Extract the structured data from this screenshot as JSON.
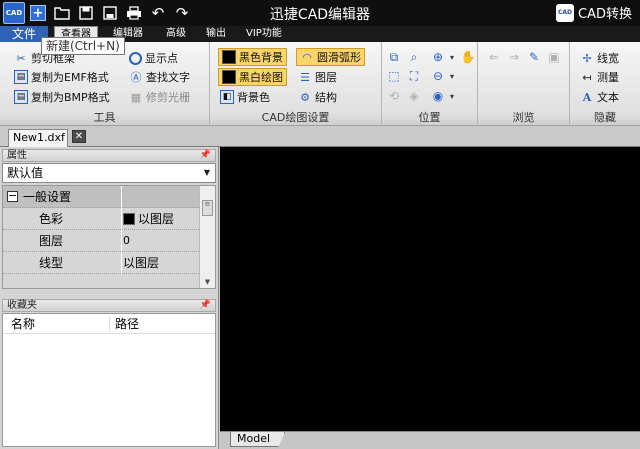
{
  "titlebar": {
    "title": "迅捷CAD编辑器",
    "logo_text": "CAD",
    "convert_badge": "CAD",
    "convert_label": "CAD转换",
    "quick_access_icons": [
      "app-logo-icon",
      "new-file-icon",
      "open-folder-icon",
      "save-icon",
      "save-as-icon",
      "print-icon",
      "undo-icon",
      "redo-icon"
    ]
  },
  "menu": {
    "tabs": [
      "文件",
      "查看器",
      "编辑器",
      "高级",
      "输出",
      "VIP功能"
    ],
    "active": "查看器"
  },
  "tooltip": {
    "text": "新建(Ctrl+N)"
  },
  "ribbon": {
    "tools": {
      "label": "工具",
      "items": [
        "剪切框架",
        "复制为EMF格式",
        "复制为BMP格式",
        "显示点",
        "查找文字",
        "修剪光栅"
      ],
      "disabled": [
        "修剪光栅"
      ]
    },
    "cad_settings": {
      "label": "CAD绘图设置",
      "items": [
        "黑色背景",
        "黑白绘图",
        "背景色",
        "圆滑弧形",
        "图层",
        "结构"
      ],
      "highlighted": [
        "黑色背景",
        "黑白绘图",
        "圆滑弧形"
      ]
    },
    "position": {
      "label": "位置"
    },
    "browse": {
      "label": "浏览"
    },
    "hidden": {
      "label": "隐藏",
      "items": [
        "线宽",
        "测量",
        "文本"
      ]
    }
  },
  "document": {
    "tab_name": "New1.dxf",
    "close_glyph": "✕"
  },
  "properties": {
    "title": "属性",
    "combo_value": "默认值",
    "category": "一般设置",
    "rows": [
      {
        "name": "色彩",
        "value": "以图层"
      },
      {
        "name": "图层",
        "value": "0"
      },
      {
        "name": "线型",
        "value": "以图层"
      }
    ]
  },
  "favorites": {
    "title": "收藏夹",
    "columns": [
      "名称",
      "路径"
    ]
  },
  "canvas": {
    "background": "#000000",
    "layout_tab": "Model"
  },
  "colors": {
    "titlebar": "#0f0f0f",
    "file_tab": "#2f63b8",
    "highlight": "#fbd46a",
    "canvas": "#000000"
  }
}
